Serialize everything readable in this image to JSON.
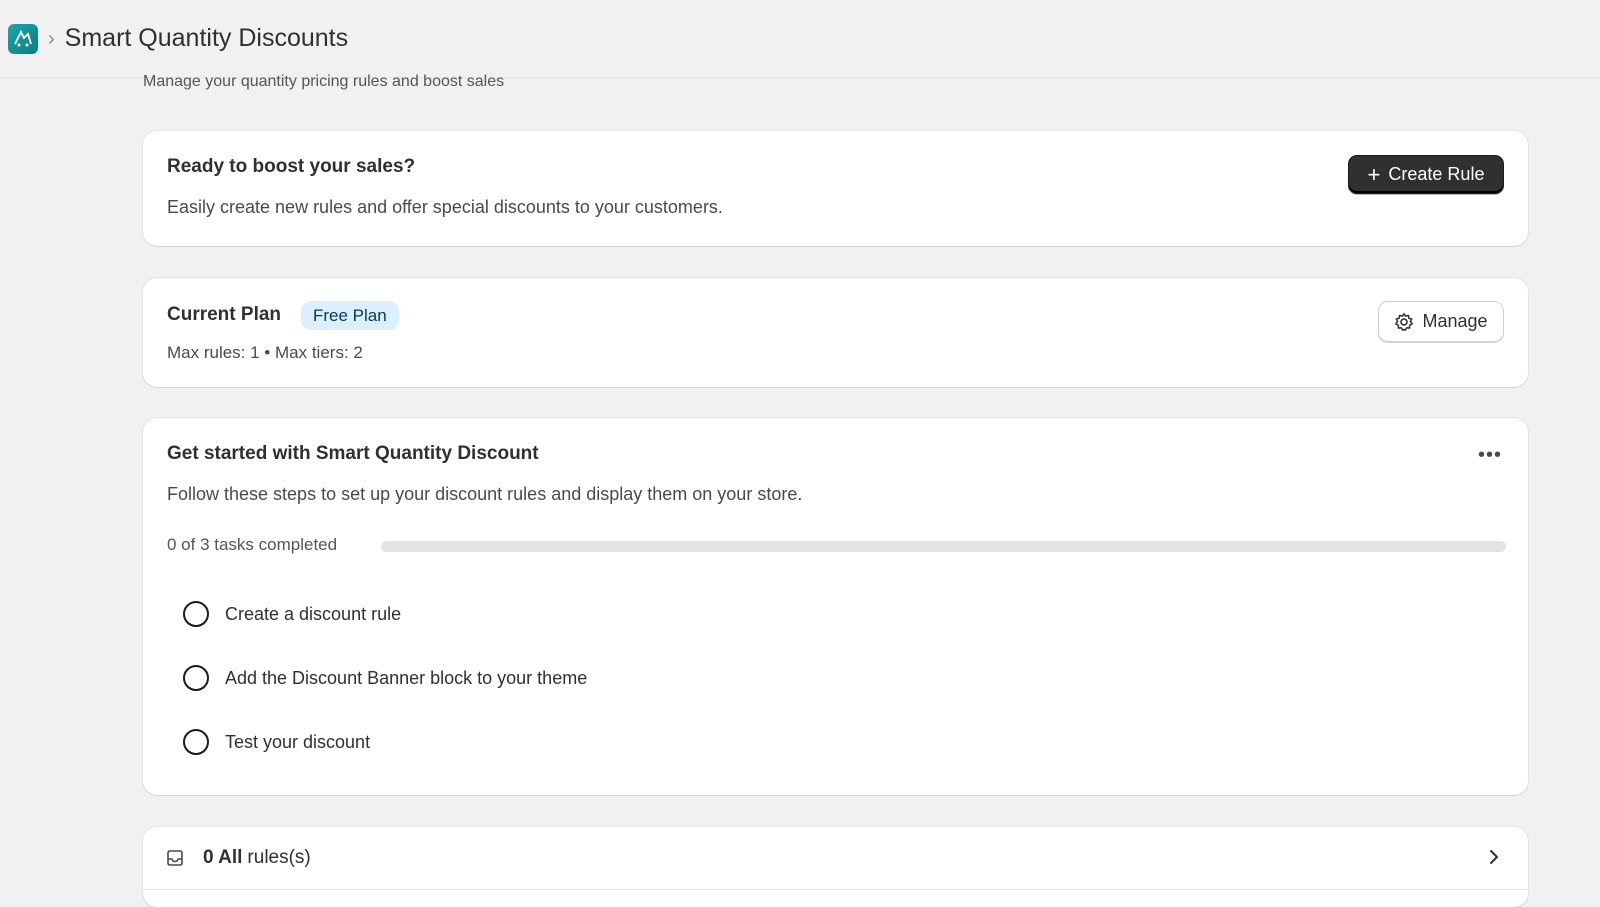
{
  "header": {
    "app_name": "Smart Quantity Discounts",
    "subtitle": "Manage your quantity pricing rules and boost sales"
  },
  "boost_card": {
    "title": "Ready to boost your sales?",
    "description": "Easily create new rules and offer special discounts to your customers.",
    "create_button_label": "Create Rule"
  },
  "plan_card": {
    "title": "Current Plan",
    "badge": "Free Plan",
    "limits": "Max rules: 1 • Max tiers: 2",
    "manage_button_label": "Manage"
  },
  "setup_card": {
    "title": "Get started with Smart Quantity Discount",
    "description": "Follow these steps to set up your discount rules and display them on your store.",
    "progress_label": "0 of 3 tasks completed",
    "progress_fraction": 0,
    "tasks": [
      {
        "label": "Create a discount rule"
      },
      {
        "label": "Add the Discount Banner block to your theme"
      },
      {
        "label": "Test your discount"
      }
    ]
  },
  "rules_card": {
    "count_label": "0 All",
    "suffix": "rules(s)"
  }
}
